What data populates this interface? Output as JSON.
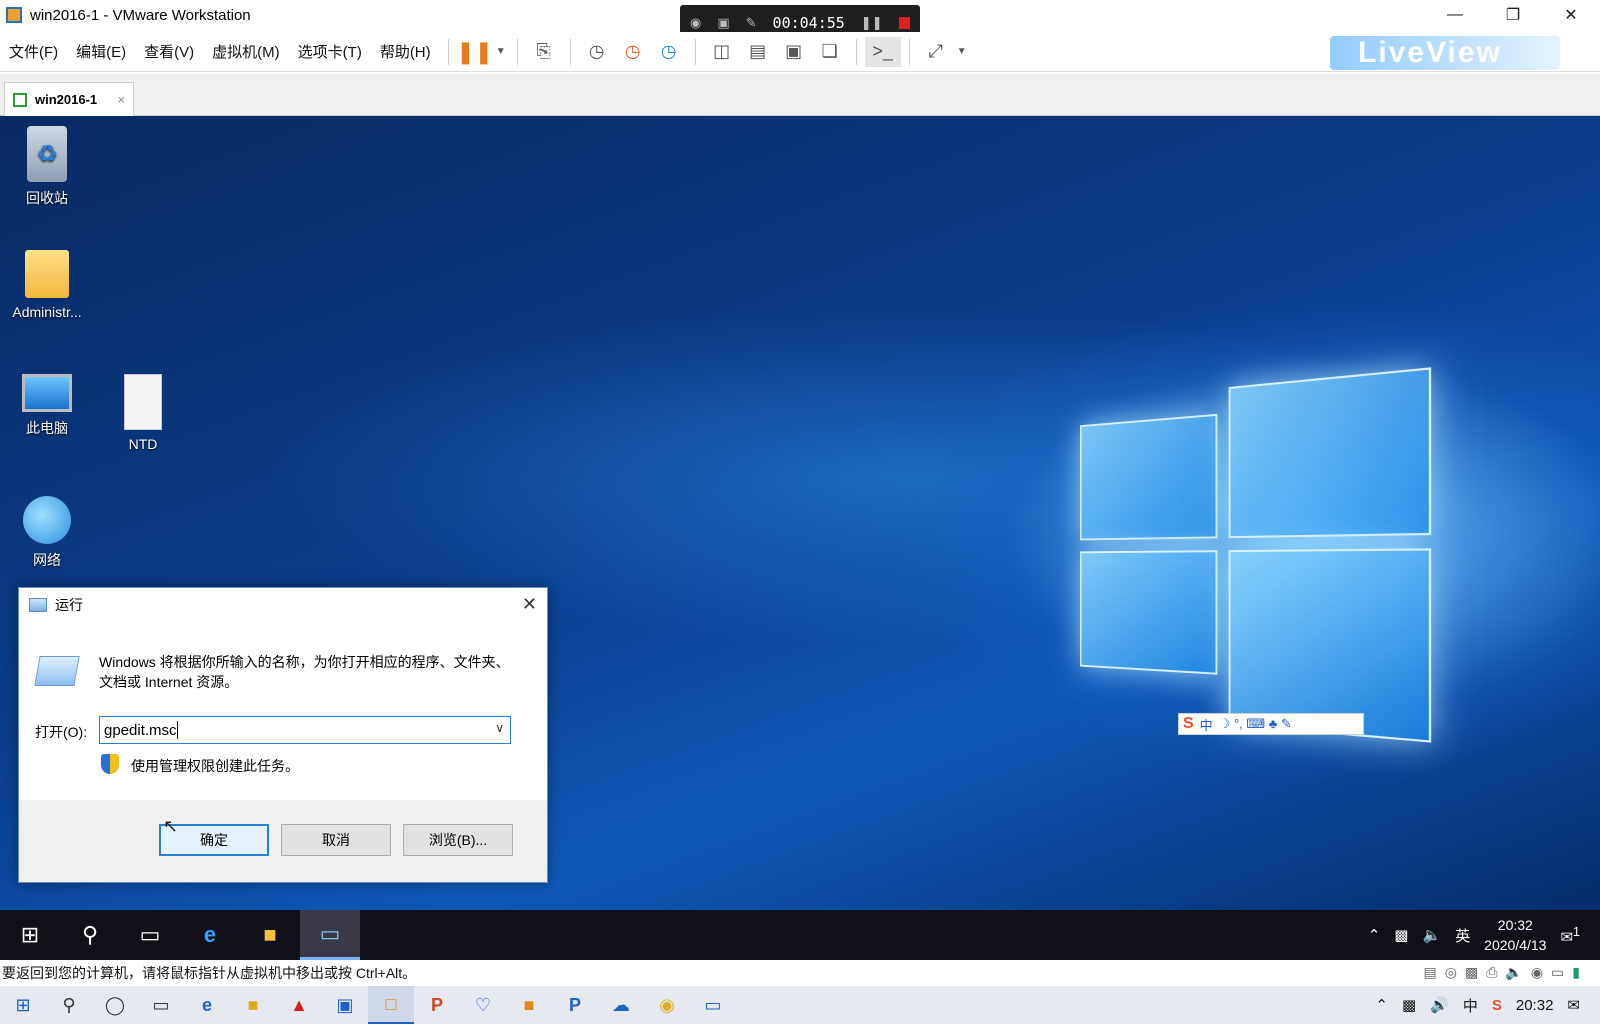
{
  "window": {
    "title": "win2016-1 - VMware Workstation",
    "minimize_icon": "minimize-icon",
    "restore_icon": "restore-icon",
    "close_icon": "close-icon"
  },
  "recorder": {
    "time": "00:04:55"
  },
  "menu": {
    "items": [
      "文件(F)",
      "编辑(E)",
      "查看(V)",
      "虚拟机(M)",
      "选项卡(T)",
      "帮助(H)"
    ]
  },
  "watermark": {
    "text": "LiveView"
  },
  "tab": {
    "label": "win2016-1",
    "close": "×"
  },
  "desktop": {
    "icons": [
      {
        "label": "回收站",
        "icon": "recycle-bin-icon"
      },
      {
        "label": "Administr...",
        "icon": "user-folder-icon"
      },
      {
        "label": "此电脑",
        "icon": "this-pc-icon"
      },
      {
        "label": "NTD",
        "icon": "text-file-icon"
      },
      {
        "label": "网络",
        "icon": "network-icon"
      }
    ]
  },
  "ime": {
    "logo": "S",
    "mode": "中",
    "symbols": "☽ °, ⌨ ♣ ✎"
  },
  "run_dialog": {
    "title": "运行",
    "description": "Windows 将根据你所输入的名称，为你打开相应的程序、文件夹、文档或 Internet 资源。",
    "open_label": "打开(O):",
    "input_value": "gpedit.msc",
    "admin_note": "使用管理权限创建此任务。",
    "ok_label": "确定",
    "cancel_label": "取消",
    "browse_label": "浏览(B)..."
  },
  "guest_taskbar": {
    "tray_lang": "英",
    "time": "20:32",
    "date": "2020/4/13",
    "notification_count": "1"
  },
  "vm_status": {
    "text": "要返回到您的计算机，请将鼠标指针从虚拟机中移出或按 Ctrl+Alt。"
  },
  "host_taskbar": {
    "tray_lang": "中",
    "time": "20:32"
  }
}
